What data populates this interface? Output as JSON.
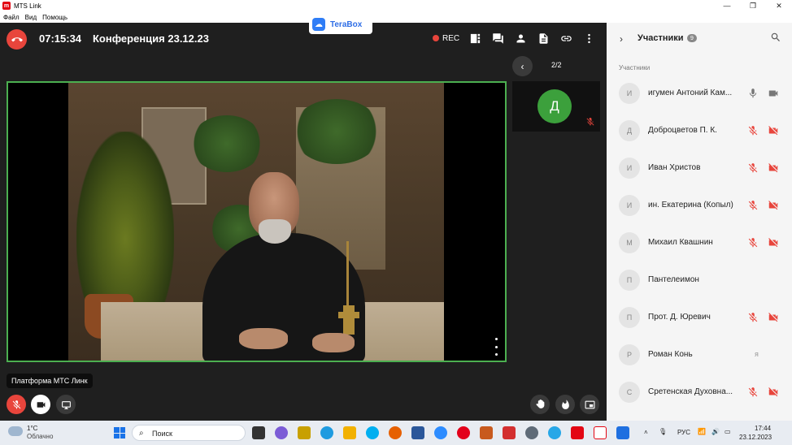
{
  "window": {
    "title": "MTS Link",
    "controls": [
      "—",
      "❐",
      "✕"
    ]
  },
  "menu": [
    "Файл",
    "Вид",
    "Помощь"
  ],
  "header": {
    "timer": "07:15:34",
    "conference_title": "Конференция 23.12.23",
    "rec_label": "REC",
    "terabox_label": "TeraBox"
  },
  "pager": {
    "count": "2/2"
  },
  "thumbnail": {
    "initial": "Д"
  },
  "tooltip": "Платформа МТС Линк",
  "panel": {
    "title": "Участники",
    "count": "9",
    "subheading": "Участники",
    "participants": [
      {
        "initial": "И",
        "name": "игумен Антоний Кам...",
        "mic": "on",
        "cam": "off-gray"
      },
      {
        "initial": "Д",
        "name": "Доброцветов П. К.",
        "mic": "muted",
        "cam": "muted"
      },
      {
        "initial": "И",
        "name": "Иван Христов",
        "mic": "muted",
        "cam": "muted"
      },
      {
        "initial": "И",
        "name": "ин. Екатерина (Копыл)",
        "mic": "muted",
        "cam": "muted"
      },
      {
        "initial": "М",
        "name": "Михаил Квашнин",
        "mic": "muted",
        "cam": "muted"
      },
      {
        "initial": "П",
        "name": "Пантелеимон",
        "mic": "none",
        "cam": "none"
      },
      {
        "initial": "П",
        "name": "Прот. Д. Юревич",
        "mic": "muted",
        "cam": "muted"
      },
      {
        "initial": "Р",
        "name": "Роман Конь",
        "mic": "none",
        "cam": "none",
        "extra": "я"
      },
      {
        "initial": "С",
        "name": "Сретенская Духовна...",
        "mic": "muted",
        "cam": "muted"
      }
    ]
  },
  "taskbar": {
    "weather_temp": "1°C",
    "weather_desc": "Облачно",
    "search_placeholder": "Поиск",
    "lang": "РУС",
    "time": "17:44",
    "date": "23.12.2023"
  },
  "colors": {
    "accent_red": "#e8453c",
    "speaker_border": "#4caf50",
    "avatar_green": "#3ca03c",
    "panel_bg": "#f5f5f5",
    "muted_icon": "#e8453c"
  }
}
